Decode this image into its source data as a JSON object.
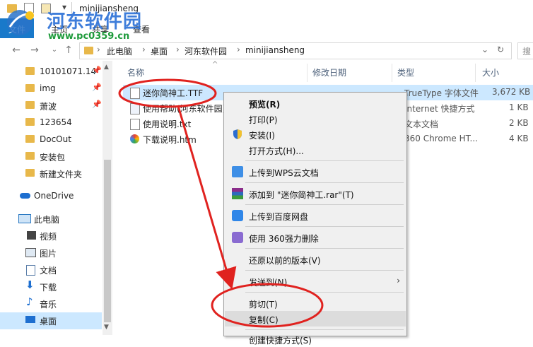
{
  "window": {
    "title": "minijiansheng"
  },
  "ribbon": {
    "tabs": [
      "文件",
      "主页",
      "共享",
      "查看"
    ]
  },
  "address": {
    "crumbs": [
      "此电脑",
      "桌面",
      "河东软件园",
      "minijiansheng"
    ],
    "search_placeholder": "搜"
  },
  "nav": {
    "quick": [
      {
        "label": "10101071.14",
        "pinned": true
      },
      {
        "label": "img",
        "pinned": true
      },
      {
        "label": "萧波",
        "pinned": true
      },
      {
        "label": "123654",
        "pinned": false
      },
      {
        "label": "DocOut",
        "pinned": false
      },
      {
        "label": "安装包",
        "pinned": false
      },
      {
        "label": "新建文件夹",
        "pinned": false
      }
    ],
    "onedrive": "OneDrive",
    "thispc": "此电脑",
    "pc_items": [
      "视频",
      "图片",
      "文档",
      "下载",
      "音乐",
      "桌面"
    ]
  },
  "columns": {
    "name": "名称",
    "date": "修改日期",
    "type": "类型",
    "size": "大小"
  },
  "files": [
    {
      "name": "迷你简神工.TTF",
      "type": "TrueType 字体文件",
      "size": "3,672 KB",
      "selected": true
    },
    {
      "name": "使用帮助(河东软件园)",
      "type": "Internet 快捷方式",
      "size": "1 KB",
      "selected": false
    },
    {
      "name": "使用说明.txt",
      "type": "文本文档",
      "size": "2 KB",
      "selected": false
    },
    {
      "name": "下载说明.htm",
      "type": "360 Chrome HT...",
      "size": "4 KB",
      "selected": false
    }
  ],
  "context_menu": {
    "items": [
      "预览(R)",
      "打印(P)",
      "安装(I)",
      "打开方式(H)...",
      "上传到WPS云文档",
      "添加到 \"迷你简神工.rar\"(T)",
      "上传到百度网盘",
      "使用 360强力删除",
      "还原以前的版本(V)",
      "发送到(N)",
      "剪切(T)",
      "复制(C)",
      "创建快捷方式(S)"
    ]
  },
  "watermark": {
    "line1": "河东软件园",
    "line2": "www.pc0359.cn"
  },
  "colors": {
    "accent": "#0078d7",
    "selection": "#cce8ff",
    "annotation": "#e0221f"
  }
}
